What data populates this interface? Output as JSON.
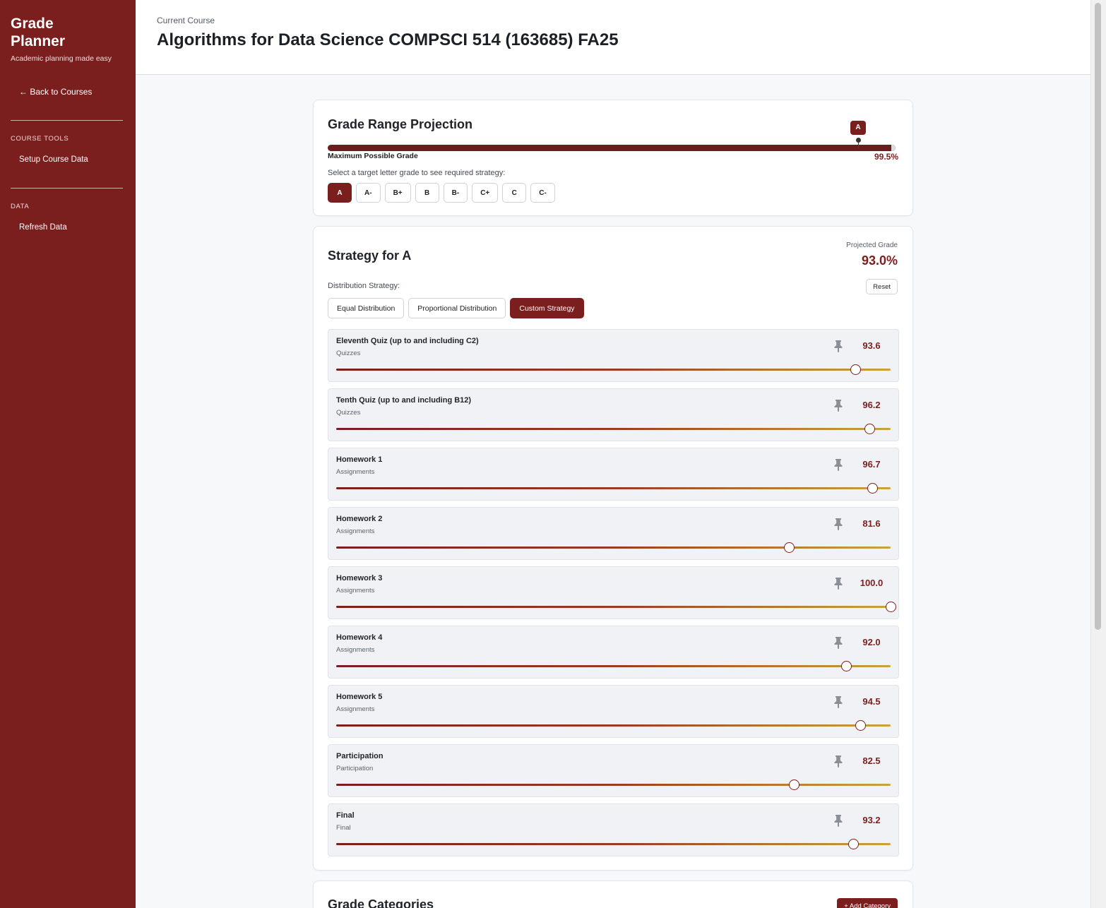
{
  "sidebar": {
    "brand": "Grade Planner",
    "tagline": "Academic planning made easy",
    "back_link": "← Back to Courses",
    "sections": [
      {
        "label": "COURSE TOOLS",
        "items": [
          "Setup Course Data"
        ]
      },
      {
        "label": "DATA",
        "items": [
          "Refresh Data"
        ]
      }
    ]
  },
  "header": {
    "kicker": "Current Course",
    "title": "Algorithms for Data Science COMPSCI 514 (163685) FA25"
  },
  "projection": {
    "title": "Grade Range Projection",
    "marker_label": "A",
    "max_label": "Maximum Possible Grade",
    "max_value": "99.5%",
    "prompt": "Select a target letter grade to see required strategy:",
    "grades": [
      "A",
      "A-",
      "B+",
      "B",
      "B-",
      "C+",
      "C",
      "C-"
    ],
    "selected_grade": "A"
  },
  "strategy": {
    "title": "Strategy for A",
    "projected_label": "Projected Grade",
    "projected_value": "93.0%",
    "distribution_label": "Distribution Strategy:",
    "reset_label": "Reset",
    "options": [
      "Equal Distribution",
      "Proportional Distribution",
      "Custom Strategy"
    ],
    "selected_option": "Custom Strategy",
    "items": [
      {
        "name": "Eleventh Quiz (up to and including C2)",
        "category": "Quizzes",
        "score": "93.6",
        "value": 93.6
      },
      {
        "name": "Tenth Quiz (up to and including B12)",
        "category": "Quizzes",
        "score": "96.2",
        "value": 96.2
      },
      {
        "name": "Homework 1",
        "category": "Assignments",
        "score": "96.7",
        "value": 96.7
      },
      {
        "name": "Homework 2",
        "category": "Assignments",
        "score": "81.6",
        "value": 81.6
      },
      {
        "name": "Homework 3",
        "category": "Assignments",
        "score": "100.0",
        "value": 100.0
      },
      {
        "name": "Homework 4",
        "category": "Assignments",
        "score": "92.0",
        "value": 92.0
      },
      {
        "name": "Homework 5",
        "category": "Assignments",
        "score": "94.5",
        "value": 94.5
      },
      {
        "name": "Participation",
        "category": "Participation",
        "score": "82.5",
        "value": 82.5
      },
      {
        "name": "Final",
        "category": "Final",
        "score": "93.2",
        "value": 93.2
      }
    ]
  },
  "categories": {
    "title": "Grade Categories",
    "add_label": "+ Add Category"
  },
  "icons": {
    "pin": "pin-icon"
  },
  "colors": {
    "brand": "#7b1e1e",
    "track_end": "#c9a43a"
  }
}
